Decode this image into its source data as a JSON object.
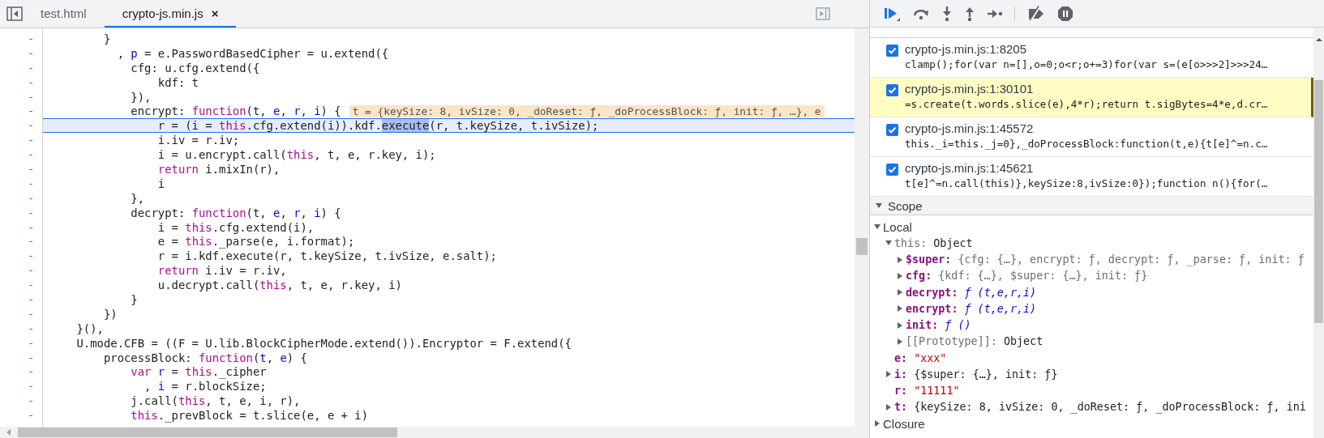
{
  "editor": {
    "tabs": [
      {
        "label": "test.html",
        "selected": false,
        "closable": false
      },
      {
        "label": "crypto-js.min.js",
        "selected": true,
        "closable": true,
        "close": "×"
      }
    ],
    "lines": [
      {
        "marker": "-",
        "current": false,
        "tokens": [
          {
            "text": "        }",
            "kind": "plain"
          }
        ]
      },
      {
        "marker": "-",
        "current": false,
        "tokens": [
          {
            "text": "          , ",
            "kind": "plain"
          },
          {
            "text": "p",
            "kind": "variable"
          },
          {
            "text": " = e.PasswordBasedCipher = u.extend({",
            "kind": "plain"
          }
        ]
      },
      {
        "marker": "-",
        "current": false,
        "tokens": [
          {
            "text": "            cfg: u.cfg.extend({",
            "kind": "plain"
          }
        ]
      },
      {
        "marker": "-",
        "current": false,
        "tokens": [
          {
            "text": "                kdf: t",
            "kind": "plain"
          }
        ]
      },
      {
        "marker": "-",
        "current": false,
        "tokens": [
          {
            "text": "            }),",
            "kind": "plain"
          }
        ]
      },
      {
        "marker": "-",
        "current": false,
        "inline_value": "t = {keySize: 8, ivSize: 0, _doReset: ƒ, _doProcessBlock: ƒ, init: ƒ, …}, e",
        "tokens": [
          {
            "text": "            encrypt: ",
            "kind": "plain"
          },
          {
            "text": "function",
            "kind": "keyword"
          },
          {
            "text": "(",
            "kind": "plain"
          },
          {
            "text": "t",
            "kind": "plain"
          },
          {
            "text": ", ",
            "kind": "plain"
          },
          {
            "text": "e",
            "kind": "variable"
          },
          {
            "text": ", ",
            "kind": "plain"
          },
          {
            "text": "r",
            "kind": "variable"
          },
          {
            "text": ", ",
            "kind": "plain"
          },
          {
            "text": "i",
            "kind": "variable"
          },
          {
            "text": ") {",
            "kind": "plain"
          }
        ]
      },
      {
        "marker": "-",
        "current": true,
        "tokens": [
          {
            "text": "                r = (i = ",
            "kind": "plain"
          },
          {
            "text": "this",
            "kind": "keyword"
          },
          {
            "text": ".cfg.extend(i)).kdf.",
            "kind": "plain"
          },
          {
            "text": "execute",
            "kind": "selection"
          },
          {
            "text": "(r, t.keySize, t.ivSize);",
            "kind": "plain"
          }
        ]
      },
      {
        "marker": "-",
        "current": false,
        "tokens": [
          {
            "text": "                i.iv = r.iv;",
            "kind": "plain"
          }
        ]
      },
      {
        "marker": "-",
        "current": false,
        "tokens": [
          {
            "text": "                i = u.encrypt.call(",
            "kind": "plain"
          },
          {
            "text": "this",
            "kind": "keyword"
          },
          {
            "text": ", t, e, r.key, i);",
            "kind": "plain"
          }
        ]
      },
      {
        "marker": "-",
        "current": false,
        "tokens": [
          {
            "text": "                return",
            "kind": "keyword"
          },
          {
            "text": " i.mixIn(r),",
            "kind": "plain"
          }
        ]
      },
      {
        "marker": "-",
        "current": false,
        "tokens": [
          {
            "text": "                i",
            "kind": "plain"
          }
        ]
      },
      {
        "marker": "-",
        "current": false,
        "tokens": [
          {
            "text": "            },",
            "kind": "plain"
          }
        ]
      },
      {
        "marker": "-",
        "current": false,
        "tokens": [
          {
            "text": "            decrypt: ",
            "kind": "plain"
          },
          {
            "text": "function",
            "kind": "keyword"
          },
          {
            "text": "(",
            "kind": "plain"
          },
          {
            "text": "t",
            "kind": "plain"
          },
          {
            "text": ", ",
            "kind": "plain"
          },
          {
            "text": "e",
            "kind": "variable"
          },
          {
            "text": ", ",
            "kind": "plain"
          },
          {
            "text": "r",
            "kind": "variable"
          },
          {
            "text": ", ",
            "kind": "plain"
          },
          {
            "text": "i",
            "kind": "variable"
          },
          {
            "text": ") {",
            "kind": "plain"
          }
        ]
      },
      {
        "marker": "-",
        "current": false,
        "tokens": [
          {
            "text": "                i = ",
            "kind": "plain"
          },
          {
            "text": "this",
            "kind": "keyword"
          },
          {
            "text": ".cfg.extend(i),",
            "kind": "plain"
          }
        ]
      },
      {
        "marker": "-",
        "current": false,
        "tokens": [
          {
            "text": "                e = ",
            "kind": "plain"
          },
          {
            "text": "this",
            "kind": "keyword"
          },
          {
            "text": "._parse(e, i.format);",
            "kind": "plain"
          }
        ]
      },
      {
        "marker": "-",
        "current": false,
        "tokens": [
          {
            "text": "                r = i.kdf.execute(r, t.keySize, t.ivSize, e.salt);",
            "kind": "plain"
          }
        ]
      },
      {
        "marker": "-",
        "current": false,
        "tokens": [
          {
            "text": "                return",
            "kind": "keyword"
          },
          {
            "text": " i.iv = r.iv,",
            "kind": "plain"
          }
        ]
      },
      {
        "marker": "-",
        "current": false,
        "tokens": [
          {
            "text": "                u.decrypt.call(",
            "kind": "plain"
          },
          {
            "text": "this",
            "kind": "keyword"
          },
          {
            "text": ", t, e, r.key, i)",
            "kind": "plain"
          }
        ]
      },
      {
        "marker": "-",
        "current": false,
        "tokens": [
          {
            "text": "            }",
            "kind": "plain"
          }
        ]
      },
      {
        "marker": "-",
        "current": false,
        "tokens": [
          {
            "text": "        })",
            "kind": "plain"
          }
        ]
      },
      {
        "marker": "-",
        "current": false,
        "tokens": [
          {
            "text": "    }(),",
            "kind": "plain"
          }
        ]
      },
      {
        "marker": "-",
        "current": false,
        "tokens": [
          {
            "text": "    U.mode.CFB = ((F = U.lib.BlockCipherMode.extend()).Encryptor = F.extend({",
            "kind": "plain"
          }
        ]
      },
      {
        "marker": "-",
        "current": false,
        "tokens": [
          {
            "text": "        processBlock: ",
            "kind": "plain"
          },
          {
            "text": "function",
            "kind": "keyword"
          },
          {
            "text": "(",
            "kind": "plain"
          },
          {
            "text": "t",
            "kind": "variable"
          },
          {
            "text": ", ",
            "kind": "plain"
          },
          {
            "text": "e",
            "kind": "variable"
          },
          {
            "text": ") {",
            "kind": "plain"
          }
        ]
      },
      {
        "marker": "-",
        "current": false,
        "tokens": [
          {
            "text": "            var",
            "kind": "keyword"
          },
          {
            "text": " r",
            "kind": "variable"
          },
          {
            "text": " = ",
            "kind": "plain"
          },
          {
            "text": "this",
            "kind": "keyword"
          },
          {
            "text": "._cipher",
            "kind": "plain"
          }
        ]
      },
      {
        "marker": "-",
        "current": false,
        "tokens": [
          {
            "text": "              , ",
            "kind": "plain"
          },
          {
            "text": "i",
            "kind": "variable"
          },
          {
            "text": " = r.blockSize;",
            "kind": "plain"
          }
        ]
      },
      {
        "marker": "-",
        "current": false,
        "tokens": [
          {
            "text": "            j.call(",
            "kind": "plain"
          },
          {
            "text": "this",
            "kind": "keyword"
          },
          {
            "text": ", t, e, i, r),",
            "kind": "plain"
          }
        ]
      },
      {
        "marker": "-",
        "current": false,
        "tokens": [
          {
            "text": "            this",
            "kind": "keyword"
          },
          {
            "text": "._prevBlock = t.slice(e, e + i)",
            "kind": "plain"
          }
        ]
      }
    ]
  },
  "debugger": {
    "breakpoints": [
      {
        "location": "crypto-js.min.js:1:8205",
        "code": "clamp();for(var n=[],o=0;o<r;o+=3)for(var s=(e[o>>>2]>>>24…",
        "checked": true,
        "selected": false
      },
      {
        "location": "crypto-js.min.js:1:30101",
        "code": "=s.create(t.words.slice(e),4*r);return t.sigBytes=4*e,d.cr…",
        "checked": true,
        "selected": true
      },
      {
        "location": "crypto-js.min.js:1:45572",
        "code": "this._i=this._j=0},_doProcessBlock:function(t,e){t[e]^=n.c…",
        "checked": true,
        "selected": false
      },
      {
        "location": "crypto-js.min.js:1:45621",
        "code": "t[e]^=n.call(this)},keySize:8,ivSize:0});function n(){for(…",
        "checked": true,
        "selected": false
      }
    ],
    "scope": {
      "title": "Scope",
      "expanded": true,
      "children": [
        {
          "kind": "scope",
          "name": "Local",
          "expanded": true,
          "children": [
            {
              "kind": "object",
              "name": "this:",
              "dim": true,
              "value": "Object",
              "expanded": true,
              "children": [
                {
                  "kind": "preview",
                  "name": "$super:",
                  "dim": false,
                  "value": "{cfg: {…}, encrypt: ƒ, decrypt: ƒ, _parse: ƒ, init: ƒ",
                  "expanded": false
                },
                {
                  "kind": "preview",
                  "name": "cfg:",
                  "dim": false,
                  "value": "{kdf: {…}, $super: {…}, init: ƒ}",
                  "expanded": false
                },
                {
                  "kind": "function",
                  "name": "decrypt:",
                  "dim": false,
                  "value": "ƒ (t,e,r,i)",
                  "expanded": false
                },
                {
                  "kind": "function",
                  "name": "encrypt:",
                  "dim": false,
                  "value": "ƒ (t,e,r,i)",
                  "expanded": false
                },
                {
                  "kind": "function",
                  "name": "init:",
                  "dim": false,
                  "value": "ƒ ()",
                  "expanded": false
                },
                {
                  "kind": "object",
                  "name": "[[Prototype]]:",
                  "dim": true,
                  "value": "Object",
                  "expanded": false
                }
              ]
            },
            {
              "kind": "string",
              "name": "e:",
              "dim": false,
              "value": "\"xxx\""
            },
            {
              "kind": "object",
              "name": "i:",
              "dim": false,
              "value": "{$super: {…}, init: ƒ}",
              "expanded": false
            },
            {
              "kind": "string",
              "name": "r:",
              "dim": false,
              "value": "\"11111\""
            },
            {
              "kind": "object",
              "name": "t:",
              "dim": false,
              "value": "{keySize: 8, ivSize: 0, _doReset: ƒ, _doProcessBlock: ƒ, ini",
              "expanded": false
            }
          ]
        },
        {
          "kind": "scope",
          "name": "Closure",
          "expanded": false
        }
      ]
    }
  }
}
